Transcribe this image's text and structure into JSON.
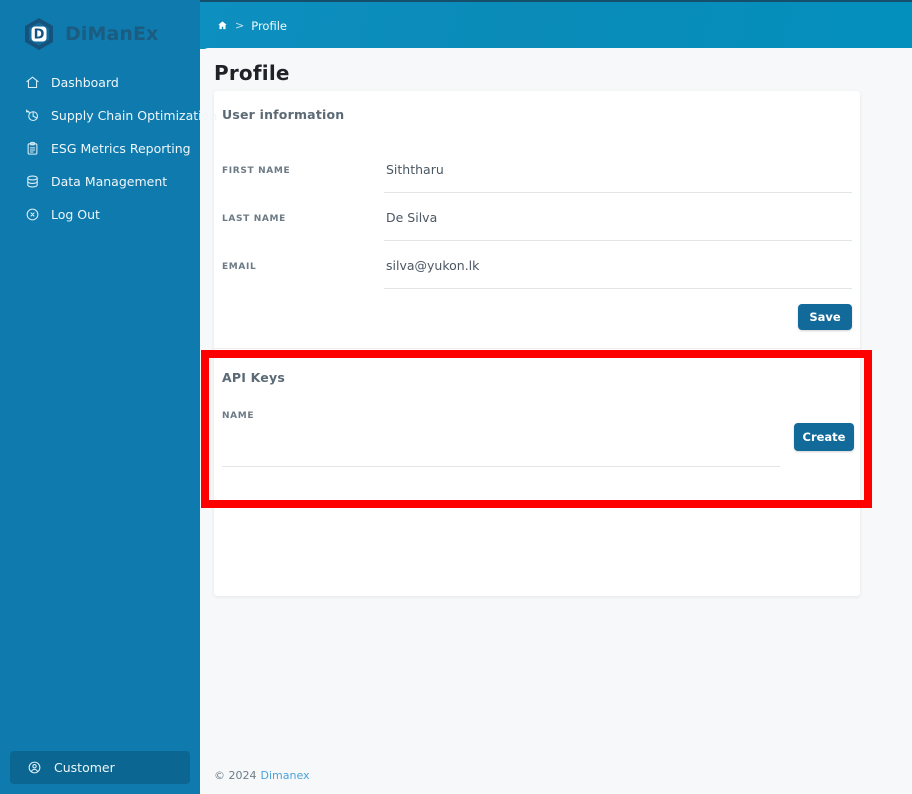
{
  "brand": {
    "name": "DiManEx",
    "logo_letter": "D",
    "sidebar_color": "#0f7aad",
    "logo_hex_color": "#16537c",
    "logo_text_color": "#1b5c80"
  },
  "sidebar": {
    "items": [
      {
        "label": "Dashboard",
        "icon": "home-icon"
      },
      {
        "label": "Supply Chain Optimization",
        "icon": "supply-chain-icon"
      },
      {
        "label": "ESG Metrics Reporting",
        "icon": "clipboard-icon"
      },
      {
        "label": "Data Management",
        "icon": "database-icon"
      },
      {
        "label": "Log Out",
        "icon": "logout-icon"
      }
    ],
    "footer": {
      "label": "Customer",
      "icon": "user-circle-icon"
    }
  },
  "breadcrumb": {
    "home_icon": "home-icon",
    "separator": ">",
    "current": "Profile"
  },
  "page": {
    "title": "Profile"
  },
  "user_information": {
    "section_title": "User information",
    "fields": [
      {
        "label": "FIRST NAME",
        "value": "Siththaru",
        "placeholder": ""
      },
      {
        "label": "LAST NAME",
        "value": "De Silva",
        "placeholder": ""
      },
      {
        "label": "EMAIL",
        "value": "silva@yukon.lk",
        "placeholder": ""
      }
    ],
    "save_label": "Save"
  },
  "api_keys": {
    "section_title": "API Keys",
    "name_label": "NAME",
    "name_value": "",
    "name_placeholder": "",
    "create_label": "Create"
  },
  "highlight": {
    "color": "#fe0000",
    "target": "api-keys-section"
  },
  "footer": {
    "copyright": "© 2024",
    "link": "Dimanex"
  }
}
